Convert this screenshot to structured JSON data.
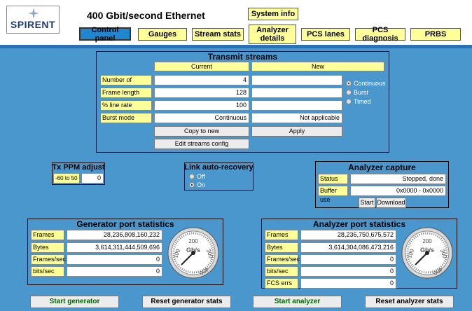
{
  "logo_text": "SPIRENT",
  "app_title": "400 Gbit/second Ethernet",
  "nav": {
    "system_info": "System info",
    "control_panel": "Control panel",
    "gauges": "Gauges",
    "stream_stats": "Stream stats",
    "analyzer_details_1": "Analyzer",
    "analyzer_details_2": "details",
    "pcs_lanes": "PCS lanes",
    "pcs_diagnosis": "PCS diagnosis",
    "prbs": "PRBS"
  },
  "transmit": {
    "title": "Transmit streams",
    "col_current": "Current",
    "col_new": "New",
    "rows": [
      {
        "label": "Number of streams",
        "current": "4",
        "new": ""
      },
      {
        "label": "Frame length",
        "current": "128",
        "new": ""
      },
      {
        "label": "% line rate",
        "current": "100",
        "new": ""
      },
      {
        "label": "Burst mode",
        "current": "Continuous",
        "new": "Not applicable"
      }
    ],
    "modes": [
      "Continuous",
      "Burst",
      "Timed"
    ],
    "copy_to_new": "Copy to new",
    "apply": "Apply",
    "edit_config": "Edit streams config"
  },
  "ppm": {
    "title": "Tx PPM adjust",
    "range": "-60 to 50",
    "value": "0"
  },
  "link_recovery": {
    "title": "Link auto-recovery",
    "off": "Off",
    "on": "On"
  },
  "capture": {
    "title": "Analyzer capture",
    "status_label": "Status",
    "status_value": "Stopped, done",
    "buffer_label": "Buffer use",
    "buffer_value": "0x0000 - 0x0000",
    "start": "Start",
    "download": "Download"
  },
  "generator": {
    "title": "Generator port statistics",
    "rows": [
      {
        "label": "Frames",
        "value": "28,236,808,160,232"
      },
      {
        "label": "Bytes",
        "value": "3,614,311,444,509,696"
      },
      {
        "label": "Frames/sec",
        "value": "0"
      },
      {
        "label": "bits/sec",
        "value": "0"
      }
    ]
  },
  "analyzer": {
    "title": "Analyzer port statistics",
    "rows": [
      {
        "label": "Frames",
        "value": "28,236,750,675,572"
      },
      {
        "label": "Bytes",
        "value": "3,614,304,086,473,216"
      },
      {
        "label": "Frames/sec",
        "value": "0"
      },
      {
        "label": "bits/sec",
        "value": "0"
      },
      {
        "label": "FCS errs",
        "value": "0"
      }
    ]
  },
  "gauge": {
    "unit": "Gb/s",
    "t100": "100",
    "t200": "200",
    "t300": "300",
    "t400": "400",
    "reading_gbps": 0
  },
  "actions": {
    "start_generator": "Start generator",
    "reset_generator": "Reset generator stats",
    "start_analyzer": "Start analyzer",
    "reset_analyzer": "Reset analyzer stats"
  },
  "colors": {
    "background": "#4a97cd",
    "button_yellow": "#ffff99",
    "active_tab": "#1f87cf",
    "start_text": "#006400"
  }
}
